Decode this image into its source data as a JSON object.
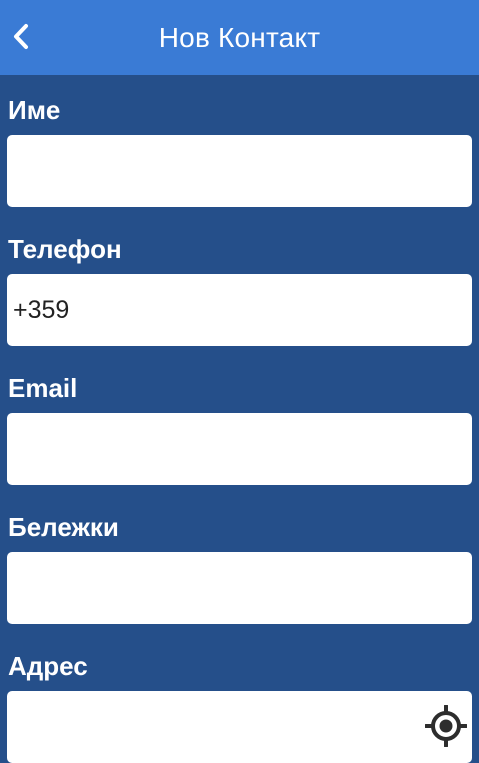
{
  "header": {
    "title": "Нов Контакт",
    "back_icon": "chevron-left-icon"
  },
  "form": {
    "name": {
      "label": "Име",
      "value": ""
    },
    "phone": {
      "label": "Телефон",
      "value": "+359"
    },
    "email": {
      "label": "Email",
      "value": ""
    },
    "notes": {
      "label": "Бележки",
      "value": ""
    },
    "address": {
      "label": "Адрес",
      "value": "",
      "action_icon": "locate-crosshair-icon"
    }
  },
  "colors": {
    "header_bg": "#3a7bd5",
    "body_bg": "#254f8a",
    "input_bg": "#ffffff",
    "label_text": "#ffffff",
    "icon_dark": "#2d2d2d"
  }
}
